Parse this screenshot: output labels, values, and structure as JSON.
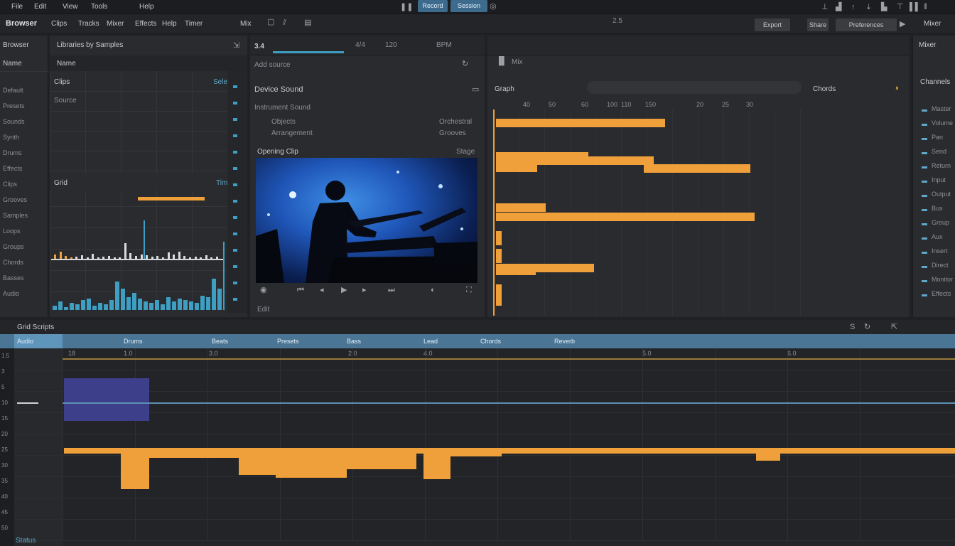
{
  "menubar": {
    "items": [
      "File",
      "Edit",
      "View",
      "Tools",
      "Help"
    ],
    "tabs": [
      "Record",
      "Session"
    ],
    "accent": "#3d6b8e"
  },
  "toolbar": {
    "title": "Browser",
    "items": [
      "Clips",
      "Tracks",
      "Mixer",
      "Effects",
      "Help",
      "Timer",
      "Mix"
    ],
    "center_readout": "2.5",
    "right_buttons": [
      "Export",
      "Share",
      "Preferences"
    ],
    "right_label": "Mixer"
  },
  "left_panel": {
    "title": "Browser",
    "subtitle": "Libraries by Samples",
    "filter": "Name",
    "items": [
      "Default",
      "Presets",
      "Sounds",
      "Synth",
      "Drums",
      "Effects",
      "Clips",
      "Grooves",
      "Samples",
      "Loops",
      "Groups",
      "Chords",
      "Basses",
      "Audio"
    ]
  },
  "analyzer": {
    "header": "Clips",
    "header_right": "Select",
    "sub": "Source",
    "section2": "Grid",
    "section2_right": "Time",
    "orange_color": "#f0a03a",
    "teal_color": "#3e9fc2"
  },
  "transport": {
    "time": "3.4",
    "fields": [
      "4/4",
      "120",
      "BPM"
    ]
  },
  "preview": {
    "placeholder": "Add source",
    "title": "Device Sound",
    "subtitle": "Instrument Sound",
    "row1_label": "Objects",
    "row1_value": "Orchestral",
    "row2_label": "Arrangement",
    "row2_value": "Grooves",
    "video_label": "Opening Clip",
    "video_right": "Stage",
    "bottom_left": "Edit"
  },
  "graph": {
    "tab_label": "Mix",
    "title": "Graph",
    "filter_label": "Chords",
    "ruler": [
      "40",
      "50",
      "60",
      "100",
      "110",
      "150",
      "20",
      "25",
      "30"
    ],
    "bar_color": "#f0a03a"
  },
  "right_panel": {
    "header": "Mixer",
    "title": "Channels",
    "items": [
      "Master",
      "Volume",
      "Pan",
      "Send",
      "Return",
      "Input",
      "Output",
      "Bus",
      "Group",
      "Aux",
      "Insert",
      "Direct",
      "Monitor",
      "Effects"
    ]
  },
  "timeline": {
    "title": "Grid Scripts",
    "tracks": [
      "Audio",
      "Drums",
      "Beats",
      "Presets",
      "Bass",
      "Lead",
      "Chords",
      "Reverb"
    ],
    "ruler": [
      "18",
      "1.0",
      "3.0",
      "2.0",
      "4.0",
      "5.0",
      "6.0"
    ],
    "left_numbers": [
      "1.5",
      "3",
      "5",
      "10",
      "15",
      "20",
      "25",
      "30",
      "35",
      "40",
      "45",
      "50"
    ],
    "status": "Status"
  }
}
